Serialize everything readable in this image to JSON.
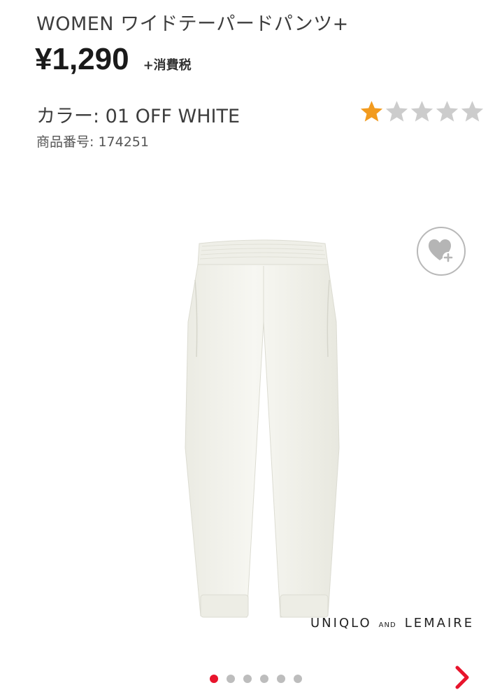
{
  "product": {
    "title": "WOMEN ワイドテーパードパンツ+",
    "price": "¥1,290",
    "tax_label": "+消費税",
    "color_label": "カラー: 01 OFF WHITE",
    "product_number_label": "商品番号: 174251"
  },
  "rating": {
    "value": 1,
    "max": 5,
    "filled_color": "#f29b1f",
    "empty_color": "#cccccc"
  },
  "favorite": {
    "icon": "heart-plus-icon"
  },
  "brand": {
    "part1": "UNIQLO",
    "part2": "AND",
    "part3": "LEMAIRE"
  },
  "carousel": {
    "total": 6,
    "active_index": 0,
    "active_color": "#e8142c",
    "next_icon": "chevron-right-icon"
  }
}
